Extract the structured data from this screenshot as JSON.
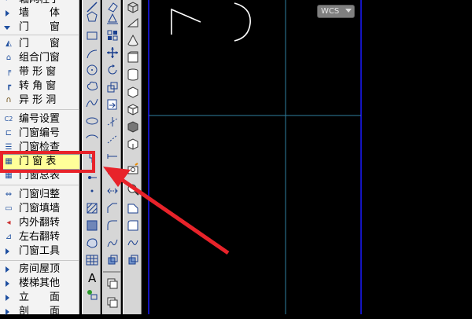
{
  "menu": {
    "items": [
      {
        "label": "轴网柱子"
      },
      {
        "label": "墙　　体"
      },
      {
        "label": "门　　窗"
      },
      {
        "label": "门　　窗"
      },
      {
        "label": "组合门窗"
      },
      {
        "label": "带 形 窗"
      },
      {
        "label": "转 角 窗"
      },
      {
        "label": "异 形 洞"
      },
      {
        "label": "编号设置"
      },
      {
        "label": "门窗编号"
      },
      {
        "label": "门窗检查"
      },
      {
        "label": "门 窗 表"
      },
      {
        "label": "门窗总表"
      },
      {
        "label": "门窗归整"
      },
      {
        "label": "门窗填墙"
      },
      {
        "label": "内外翻转"
      },
      {
        "label": "左右翻转"
      },
      {
        "label": "门窗工具"
      },
      {
        "label": "房间屋顶"
      },
      {
        "label": "楼梯其他"
      },
      {
        "label": "立　　面"
      },
      {
        "label": "剖　　面"
      }
    ],
    "selected_index": 11
  },
  "toolbar": {
    "icons": [
      "line-icon",
      "polygon-icon",
      "rectangle-icon",
      "arc-icon",
      "circle-icon",
      "cloud-icon",
      "spline-icon",
      "ellipse-icon",
      "ellipse-arc-icon",
      "insert-block-icon",
      "point-icon",
      "hatch-icon",
      "gradient-icon",
      "region-icon",
      "table-icon",
      "text-icon",
      "add-selected-icon"
    ],
    "modify_icons": [
      "erase-icon",
      "copy-icon",
      "mirror-icon",
      "offset-icon",
      "array-icon",
      "move-icon",
      "rotate-icon",
      "scale-icon",
      "stretch-icon",
      "trim-icon",
      "extend-icon",
      "break-icon",
      "join-icon",
      "chamfer-icon",
      "fillet-icon",
      "blend-icon",
      "explode-icon"
    ],
    "view_icons": [
      "box-icon",
      "wedge-icon",
      "cone-icon",
      "sphere-icon",
      "cylinder-icon",
      "torus-icon",
      "pyramid-icon",
      "extrude-icon",
      "revolve-icon",
      "sweep-icon",
      "loft-icon",
      "camera-icon",
      "zoom-icon"
    ]
  },
  "canvas": {
    "ucs_label": "WCS",
    "bg": "#000000",
    "grid_color": "#2f7fa0",
    "frame_color": "#1a1aff",
    "sketch_color": "#ffffff"
  },
  "annotation": {
    "highlight_color": "#e8232a"
  }
}
